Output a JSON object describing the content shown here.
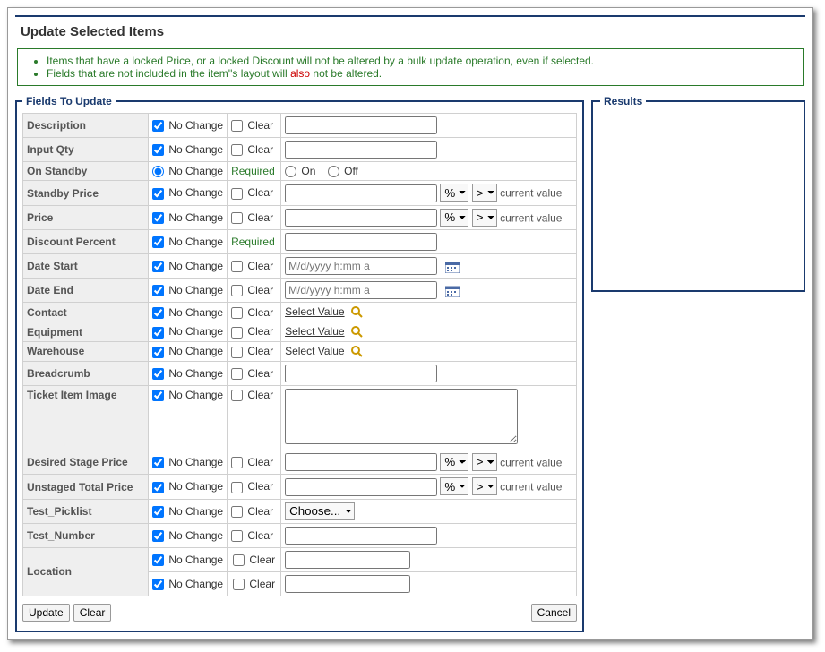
{
  "title": "Update Selected Items",
  "notice": {
    "line1": "Items that have a locked Price, or a locked Discount will not be altered by a bulk update operation, even if selected.",
    "line2a": "Fields that are not included in the item''s layout will ",
    "line2b": "also",
    "line2c": " not be altered."
  },
  "legend_fields": "Fields To Update",
  "legend_results": "Results",
  "nochange": "No Change",
  "clear": "Clear",
  "required": "Required",
  "current_value": "current value",
  "select_value": "Select Value",
  "on": "On",
  "off": "Off",
  "pct": "%",
  "gt": ">",
  "choose": "Choose...",
  "date_ph": "M/d/yyyy h:mm a",
  "labels": {
    "description": "Description",
    "input_qty": "Input Qty",
    "on_standby": "On Standby",
    "standby_price": "Standby Price",
    "price": "Price",
    "discount_percent": "Discount Percent",
    "date_start": "Date Start",
    "date_end": "Date End",
    "contact": "Contact",
    "equipment": "Equipment",
    "warehouse": "Warehouse",
    "breadcrumb": "Breadcrumb",
    "ticket_item_image": "Ticket Item Image",
    "desired_stage_price": "Desired Stage Price",
    "unstaged_total_price": "Unstaged Total Price",
    "test_picklist": "Test_Picklist",
    "test_number": "Test_Number",
    "location": "Location"
  },
  "buttons": {
    "update": "Update",
    "clear": "Clear",
    "cancel": "Cancel"
  }
}
